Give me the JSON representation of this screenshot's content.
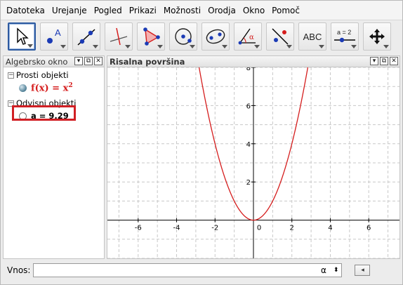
{
  "menu": [
    "Datoteka",
    "Urejanje",
    "Pogled",
    "Prikazi",
    "Možnosti",
    "Orodja",
    "Okno",
    "Pomoč"
  ],
  "toolbar": {
    "tools": [
      {
        "icon": "move-arrow-icon",
        "active": true
      },
      {
        "icon": "new-point-icon",
        "label": "A"
      },
      {
        "icon": "line-through-two-points-icon"
      },
      {
        "icon": "perpendicular-line-icon"
      },
      {
        "icon": "polygon-icon"
      },
      {
        "icon": "circle-center-point-icon"
      },
      {
        "icon": "ellipse-icon"
      },
      {
        "icon": "angle-icon",
        "label": "α"
      },
      {
        "icon": "reflect-about-line-icon"
      },
      {
        "icon": "text-icon",
        "label": "ABC"
      },
      {
        "icon": "slider-icon",
        "label": "a = 2"
      },
      {
        "icon": "move-graphics-view-icon"
      }
    ]
  },
  "algebra": {
    "title": "Algebrsko okno",
    "buttons": [
      "▾",
      "⧉",
      "✕"
    ],
    "groups": [
      {
        "label": "Prosti objekti",
        "items": [
          {
            "prefix": "f(x)",
            "eq": " = x",
            "sup": "2"
          }
        ]
      },
      {
        "label": "Odvisni objekti",
        "items": [
          {
            "text": "a = 9.29"
          }
        ]
      }
    ]
  },
  "graphics": {
    "title": "Risalna površina",
    "buttons": [
      "▾",
      "⧉",
      "✕"
    ]
  },
  "chart_data": {
    "type": "line",
    "series": [
      {
        "function": "x^2"
      }
    ],
    "xlim": [
      -7.6,
      7.6
    ],
    "ylim": [
      -2.0,
      8.0
    ],
    "xticks": [
      -6,
      -4,
      -2,
      0,
      2,
      4,
      6
    ],
    "yticks": [
      2,
      4,
      6,
      8
    ],
    "x_tick_labels": [
      "-6",
      "-4",
      "-2",
      "0",
      "2",
      "4",
      "6"
    ],
    "y_tick_labels": [
      "2",
      "4",
      "6",
      "8"
    ],
    "grid": true,
    "curve_color": "#d51d1d"
  },
  "input": {
    "label": "Vnos:",
    "value": "",
    "alpha_button": "α",
    "spinner": "⬍",
    "help_button": "◂"
  }
}
